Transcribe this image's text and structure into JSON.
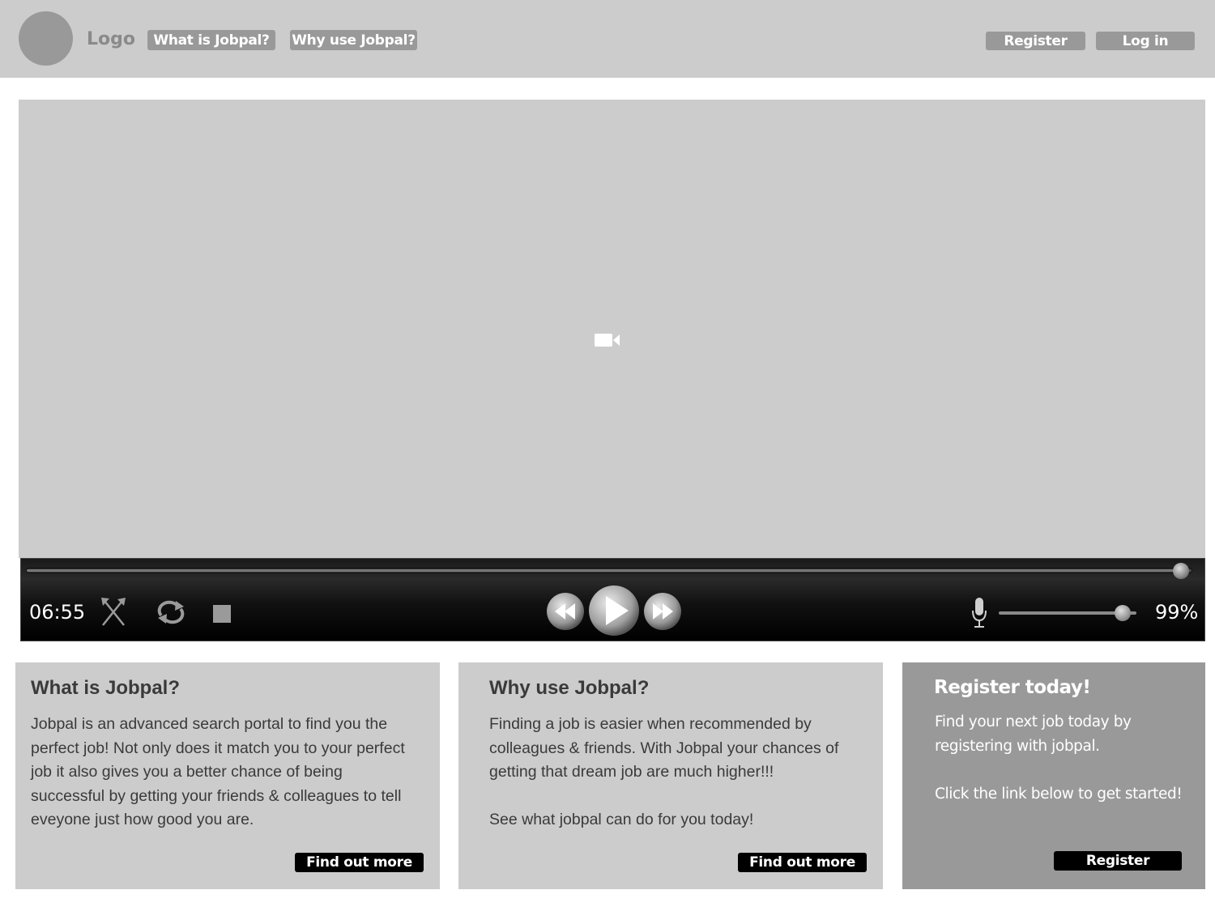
{
  "header": {
    "logo_label": "Logo",
    "nav": {
      "what_label": "What is Jobpal?",
      "why_label": "Why use Jobpal?"
    },
    "register_label": "Register",
    "login_label": "Log in"
  },
  "video": {
    "placeholder_icon": "video-camera-icon",
    "time": "06:55",
    "progress_fraction": 0.99,
    "volume_fraction": 0.9,
    "volume_display": "99%",
    "icons": [
      "shuffle-icon",
      "repeat-icon",
      "stop-icon",
      "rewind-icon",
      "play-icon",
      "fast-forward-icon",
      "microphone-icon"
    ]
  },
  "panels": {
    "what": {
      "title": "What is Jobpal?",
      "body": "Jobpal is an advanced search portal to find you the perfect job! Not only does it match you to your perfect job it also gives you a better chance of being successful by getting your friends & colleagues to tell eveyone just how good you are.",
      "button_label": "Find out more"
    },
    "why": {
      "title": "Why use Jobpal?",
      "body": "Finding a job is easier when recommended by colleagues & friends. With Jobpal your chances of getting that dream job are much higher!!!\n\nSee what jobpal can do for you today!",
      "button_label": "Find out more"
    },
    "register": {
      "title": "Register today!",
      "body": "Find your next job today by registering with jobpal.\n\nClick the link below to get started!",
      "button_label": "Register"
    }
  },
  "colors": {
    "header_bg": "#cccccc",
    "logo_circle": "#999999",
    "nav_button_bg": "#999999",
    "panel_bg": "#cccccc",
    "register_panel_bg": "#999999",
    "cta_button_bg": "#000000"
  }
}
